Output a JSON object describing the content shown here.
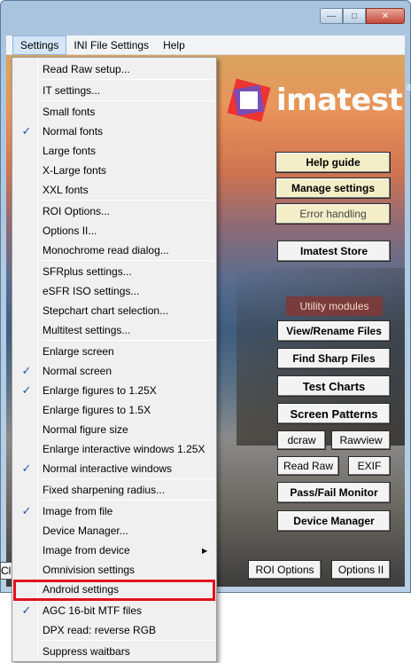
{
  "window": {
    "minimize": "—",
    "maximize": "□",
    "close": "✕"
  },
  "menubar": {
    "items": [
      "Settings",
      "INI File Settings",
      "Help"
    ]
  },
  "logo": {
    "text": "imatest",
    "reg": "®"
  },
  "right_panel": {
    "help_guide": "Help guide",
    "manage_settings": "Manage settings",
    "error_handling": "Error handling",
    "store": "Imatest Store",
    "utility_modules": "Utility modules",
    "view_rename": "View/Rename Files",
    "find_sharp": "Find Sharp Files",
    "test_charts": "Test Charts",
    "screen_patterns": "Screen Patterns",
    "dcraw": "dcraw",
    "rawview": "Rawview",
    "read_raw": "Read Raw",
    "exif": "EXIF",
    "pass_fail": "Pass/Fail Monitor",
    "device_manager": "Device Manager",
    "roi_options": "ROI Options",
    "options_ii": "Options II",
    "bottom_left": "Clo"
  },
  "dropdown": {
    "items": [
      {
        "label": "Read Raw setup...",
        "checked": false
      },
      {
        "label": "IT settings...",
        "checked": false
      },
      {
        "label": "Small fonts",
        "checked": false
      },
      {
        "label": "Normal fonts",
        "checked": true
      },
      {
        "label": "Large fonts",
        "checked": false
      },
      {
        "label": "X-Large fonts",
        "checked": false
      },
      {
        "label": "XXL fonts",
        "checked": false
      },
      {
        "label": "ROI Options...",
        "checked": false
      },
      {
        "label": "Options II...",
        "checked": false
      },
      {
        "label": "Monochrome read dialog...",
        "checked": false
      },
      {
        "label": "SFRplus settings...",
        "checked": false
      },
      {
        "label": "eSFR ISO settings...",
        "checked": false
      },
      {
        "label": "Stepchart chart selection...",
        "checked": false
      },
      {
        "label": "Multitest settings...",
        "checked": false
      },
      {
        "label": "Enlarge screen",
        "checked": false
      },
      {
        "label": "Normal screen",
        "checked": true
      },
      {
        "label": "Enlarge figures to 1.25X",
        "checked": true
      },
      {
        "label": "Enlarge figures to 1.5X",
        "checked": false
      },
      {
        "label": "Normal figure size",
        "checked": false
      },
      {
        "label": "Enlarge interactive windows 1.25X",
        "checked": false
      },
      {
        "label": "Normal interactive windows",
        "checked": true
      },
      {
        "label": "Fixed sharpening radius...",
        "checked": false
      },
      {
        "label": "Image from file",
        "checked": true
      },
      {
        "label": "Device Manager...",
        "checked": false
      },
      {
        "label": "Image from device",
        "checked": false,
        "submenu": true
      },
      {
        "label": "Omnivision settings",
        "checked": false
      },
      {
        "label": "Android settings",
        "checked": false,
        "highlighted": true
      },
      {
        "label": "AGC 16-bit MTF files",
        "checked": true
      },
      {
        "label": "DPX read: reverse RGB",
        "checked": false
      },
      {
        "label": "Suppress waitbars",
        "checked": false
      }
    ],
    "check_glyph": "✓",
    "submenu_glyph": "▶"
  }
}
